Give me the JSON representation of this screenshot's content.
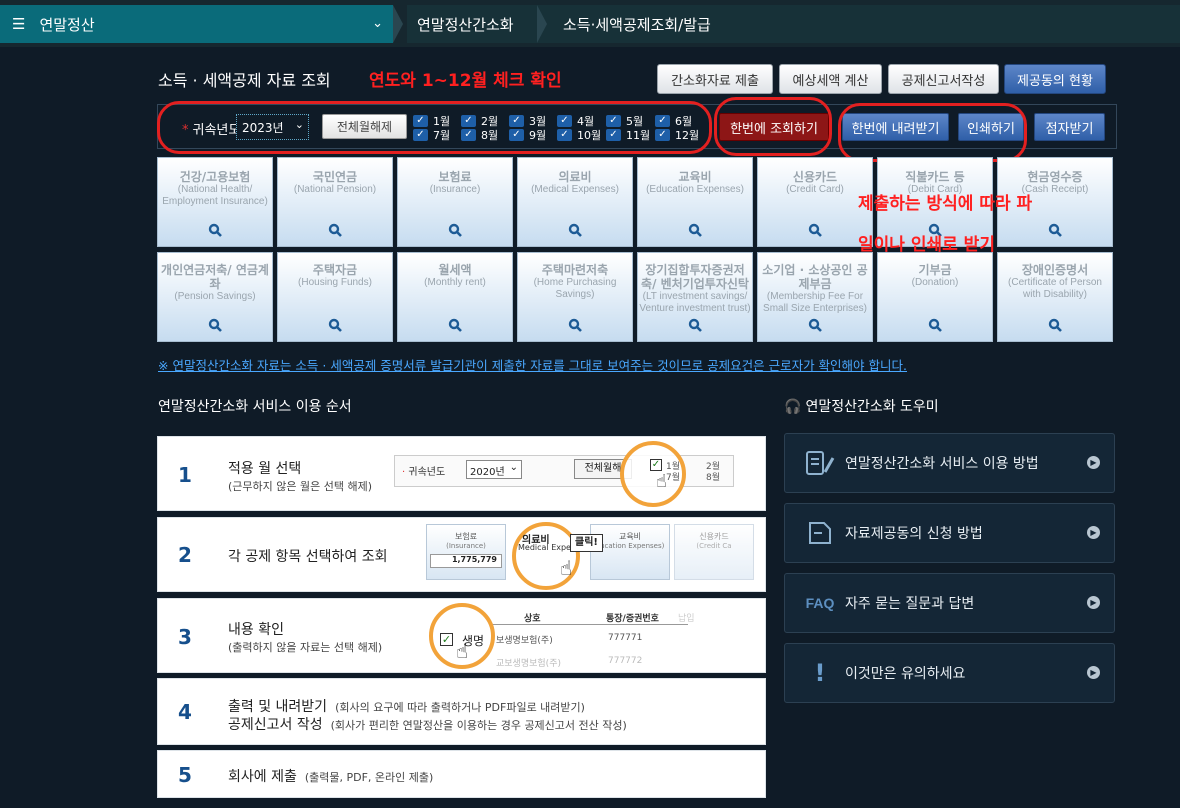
{
  "topbar": {
    "menu_icon": "hamburger-icon",
    "title": "연말정산",
    "crumb1": "연말정산간소화",
    "crumb2": "소득·세액공제조회/발급"
  },
  "header": {
    "title": "소득 · 세액공제 자료 조회",
    "buttons": [
      "간소화자료 제출",
      "예상세액 계산",
      "공제신고서작성",
      "제공동의 현황"
    ]
  },
  "filter": {
    "year_label": "귀속년도",
    "year_value": "2023년",
    "clear_all": "전체월해제",
    "months": [
      "1월",
      "2월",
      "3월",
      "4월",
      "5월",
      "6월",
      "7월",
      "8월",
      "9월",
      "10월",
      "11월",
      "12월"
    ],
    "query_all": "한번에 조회하기",
    "download_all": "한번에 내려받기",
    "print": "인쇄하기",
    "braille": "점자받기"
  },
  "tiles": [
    {
      "name": "건강/고용보험",
      "en": "(National Health/ Employment Insurance)"
    },
    {
      "name": "국민연금",
      "en": "(National Pension)"
    },
    {
      "name": "보험료",
      "en": "(Insurance)"
    },
    {
      "name": "의료비",
      "en": "(Medical Expenses)"
    },
    {
      "name": "교육비",
      "en": "(Education Expenses)"
    },
    {
      "name": "신용카드",
      "en": "(Credit Card)"
    },
    {
      "name": "직불카드 등",
      "en": "(Debit Card)"
    },
    {
      "name": "현금영수증",
      "en": "(Cash Receipt)"
    },
    {
      "name": "개인연금저축/ 연금계좌",
      "en": "(Pension Savings)"
    },
    {
      "name": "주택자금",
      "en": "(Housing Funds)"
    },
    {
      "name": "월세액",
      "en": "(Monthly rent)"
    },
    {
      "name": "주택마련저축",
      "en": "(Home Purchasing Savings)"
    },
    {
      "name": "장기집합투자증권저축/ 벤처기업투자신탁",
      "en": "(LT investment savings/ Venture investment trust)"
    },
    {
      "name": "소기업 · 소상공인 공제부금",
      "en": "(Membership Fee For Small Size Enterprises)"
    },
    {
      "name": "기부금",
      "en": "(Donation)"
    },
    {
      "name": "장애인증명서",
      "en": "(Certificate of Person with Disability)"
    }
  ],
  "notice": "※ 연말정산간소화 자료는 소득 · 세액공제 증명서류 발급기관이 제출한 자료를 그대로 보여주는 것이므로 공제요건은 근로자가 확인해야 합니다.",
  "annotations": {
    "a1": "연도와 1~12월 체크 확인",
    "a2_line1": "제출하는 방식에 따라 파",
    "a2_line2": "일이나 인쇄로 받기"
  },
  "steps": {
    "title": "연말정산간소화 서비스 이용 순서",
    "items": [
      {
        "num": "1",
        "title": "적용 월 선택",
        "sub": "(근무하지 않은 월은 선택 해제)"
      },
      {
        "num": "2",
        "title": "각 공제 항목 선택하여 조회",
        "sub": ""
      },
      {
        "num": "3",
        "title": "내용 확인",
        "sub": "(출력하지 않을 자료는 선택 해제)"
      },
      {
        "num": "4",
        "title": "출력 및 내려받기",
        "title2": "공제신고서 작성",
        "sub": "(회사의 요구에 따라 출력하거나 PDF파일로 내려받기)",
        "sub2": "(회사가 편리한 연말정산을 이용하는 경우 공제신고서 전산 작성)"
      },
      {
        "num": "5",
        "title": "회사에 제출",
        "sub": "(출력물, PDF, 온라인 제출)"
      }
    ],
    "ill1": {
      "label": "귀속년도",
      "year": "2020년",
      "clear": "전체월해",
      "m1": "1월",
      "m2": "2월",
      "m7": "7월",
      "m8": "8월"
    },
    "ill2": {
      "t1": "보험료",
      "e1": "(Insurance)",
      "val": "1,775,779",
      "t2": "의료비",
      "e2": "Medical Expen",
      "t3": "교육비",
      "e3": "ducation Expenses)",
      "t4": "신용카드",
      "e4": "(Credit Ca",
      "click": "클릭!"
    },
    "ill3": {
      "h1": "상호",
      "h2": "통장/증권번호",
      "h3": "납입",
      "c1": "생명",
      "c2": "보생명보험(주)",
      "c3": "777771",
      "c4": "교보생명보험(주)",
      "c5": "777772"
    }
  },
  "help": {
    "title": "연말정산간소화 도우미",
    "items": [
      "연말정산간소화 서비스 이용 방법",
      "자료제공동의 신청 방법",
      "자주 묻는 질문과 답변",
      "이것만은 유의하세요"
    ],
    "faq_text": "FAQ"
  }
}
